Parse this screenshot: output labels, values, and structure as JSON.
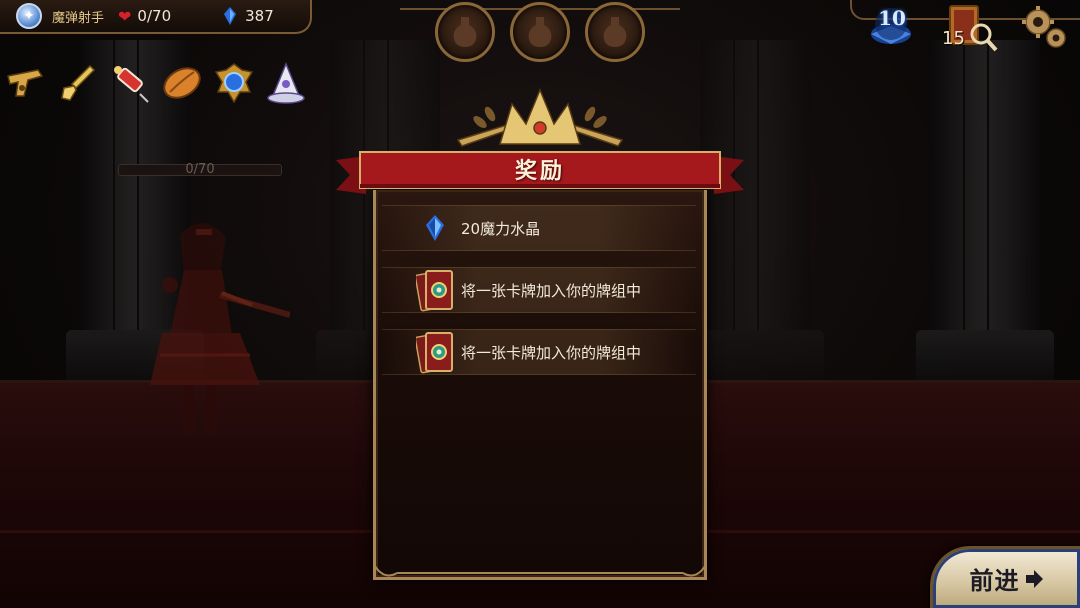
{
  "player": {
    "class_name": "魔弹射手",
    "hp": "0/70",
    "crystals": "387",
    "hp_bar_text": "0/70",
    "hp_fraction": 0
  },
  "top_right": {
    "level": "10",
    "deck_count": "15"
  },
  "potion_slots": [
    "empty",
    "empty",
    "empty"
  ],
  "relics": [
    "flintlock-pistol-icon",
    "shovel-icon",
    "syringe-icon",
    "cocoa-bean-icon",
    "blue-gem-icon",
    "wizard-hat-icon"
  ],
  "reward_panel": {
    "title": "奖励",
    "rewards": [
      {
        "icon": "crystal-icon",
        "label": "20魔力水晶"
      },
      {
        "icon": "card-back-icon",
        "label": "将一张卡牌加入你的牌组中"
      },
      {
        "icon": "card-back-icon",
        "label": "将一张卡牌加入你的牌组中"
      }
    ]
  },
  "proceed_button": {
    "label": "前进"
  },
  "colors": {
    "banner_red": "#a5191d",
    "panel_border": "#a98656",
    "crystal_blue": "#2a6fe0"
  }
}
